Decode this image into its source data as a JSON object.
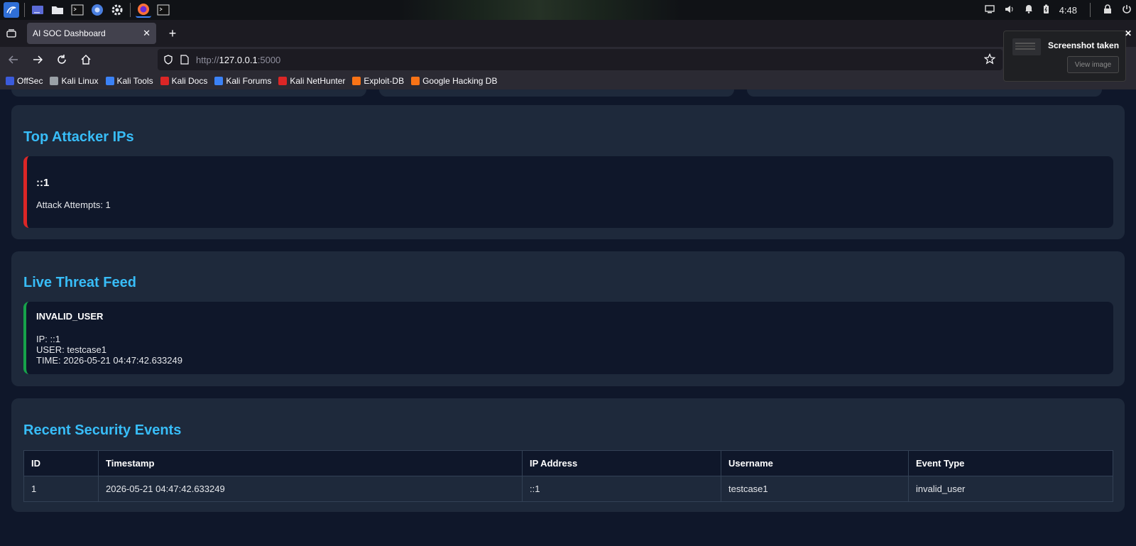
{
  "taskbar": {
    "clock": "4:48",
    "apps": [
      "kali-menu-icon",
      "desktop-icon",
      "file-manager-icon",
      "terminal-icon",
      "chromium-icon",
      "settings-icon",
      "firefox-icon",
      "terminal-icon"
    ]
  },
  "browser": {
    "tab_title": "AI SOC Dashboard",
    "tab_close": "✕",
    "url_scheme": "http://",
    "url_host": "127.0.0.1",
    "url_port": ":5000",
    "bookmarks": [
      {
        "label": "OffSec",
        "color": "#3b5bdb"
      },
      {
        "label": "Kali Linux",
        "color": "#9aa0a6"
      },
      {
        "label": "Kali Tools",
        "color": "#3b82f6"
      },
      {
        "label": "Kali Docs",
        "color": "#dc2626"
      },
      {
        "label": "Kali Forums",
        "color": "#3b82f6"
      },
      {
        "label": "Kali NetHunter",
        "color": "#dc2626"
      },
      {
        "label": "Exploit-DB",
        "color": "#f97316"
      },
      {
        "label": "Google Hacking DB",
        "color": "#f97316"
      }
    ]
  },
  "notification": {
    "title": "Screenshot taken",
    "button": "View image"
  },
  "attackers": {
    "heading": "Top Attacker IPs",
    "items": [
      {
        "ip": "::1",
        "attempts": "Attack Attempts: 1"
      }
    ]
  },
  "feed": {
    "heading": "Live Threat Feed",
    "items": [
      {
        "type": "INVALID_USER",
        "ip": "IP: ::1",
        "user": "USER: testcase1",
        "time": "TIME: 2026-05-21 04:47:42.633249"
      }
    ]
  },
  "events": {
    "heading": "Recent Security Events",
    "columns": [
      "ID",
      "Timestamp",
      "IP Address",
      "Username",
      "Event Type"
    ],
    "rows": [
      [
        "1",
        "2026-05-21 04:47:42.633249",
        "::1",
        "testcase1",
        "invalid_user"
      ]
    ]
  },
  "colors": {
    "accent": "#38bdf8",
    "attacker_border": "#dc2626",
    "feed_border": "#16a34a",
    "page_bg": "#0f172a",
    "card_bg": "#1e293b"
  }
}
